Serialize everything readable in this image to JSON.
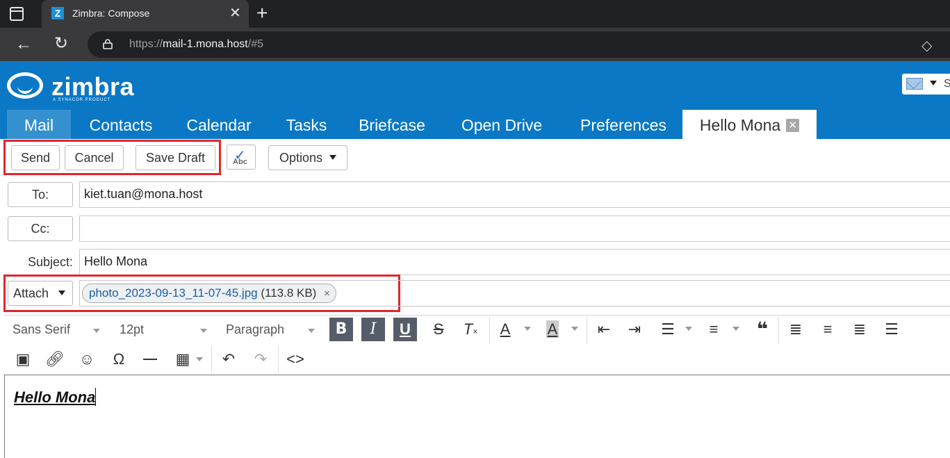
{
  "browser": {
    "tab_title": "Zimbra: Compose",
    "tab_favicon": "Z",
    "url_prefix": "https://",
    "url_host": "mail-1.mona.host",
    "url_suffix": "/#5"
  },
  "zimbra": {
    "logo_text": "zimbra",
    "logo_subtitle": "A SYNACOR PRODUCT",
    "search_letter": "S",
    "tabs": [
      {
        "label": "Mail"
      },
      {
        "label": "Contacts"
      },
      {
        "label": "Calendar"
      },
      {
        "label": "Tasks"
      },
      {
        "label": "Briefcase"
      },
      {
        "label": "Open Drive"
      },
      {
        "label": "Preferences"
      },
      {
        "label": "Hello Mona"
      }
    ],
    "compose_close": "✕"
  },
  "toolbar": {
    "send": "Send",
    "cancel": "Cancel",
    "save_draft": "Save Draft",
    "spell_abc": "Abc",
    "options": "Options"
  },
  "compose": {
    "to_label": "To:",
    "to_value": "kiet.tuan@mona.host",
    "cc_label": "Cc:",
    "cc_value": "",
    "subject_label": "Subject:",
    "subject_value": "Hello Mona",
    "attach_label": "Attach",
    "attachment": {
      "name": "photo_2023-09-13_11-07-45.jpg",
      "size": "(113.8 KB)",
      "remove": "×"
    }
  },
  "editor": {
    "font_family": "Sans Serif",
    "font_size": "12pt",
    "block_format": "Paragraph",
    "body_text": "Hello Mona",
    "bold_pressed": true,
    "italic_pressed": true,
    "underline_pressed": true
  },
  "colors": {
    "header_blue": "#0a78c5",
    "active_tab": "#3590d0",
    "highlight_red": "#e1252b"
  }
}
